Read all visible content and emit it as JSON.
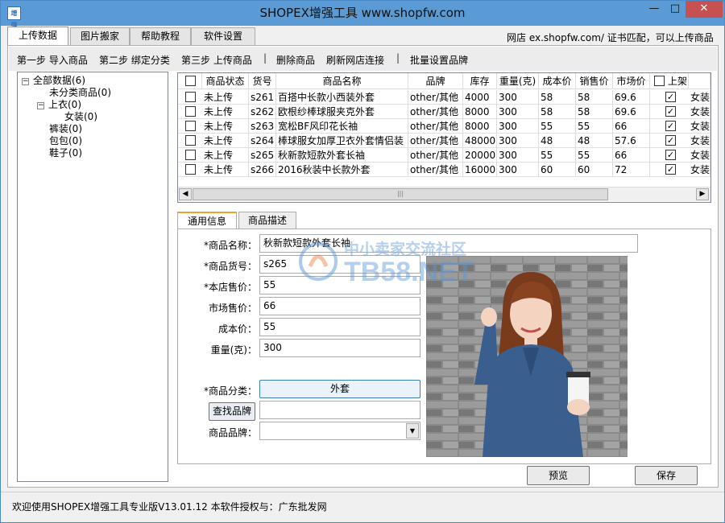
{
  "window": {
    "title": "SHOPEX增强工具 www.shopfw.com",
    "icon_text": "增强"
  },
  "main_tabs": [
    "上传数据",
    "图片搬家",
    "帮助教程",
    "软件设置"
  ],
  "notice": "网店 ex.shopfw.com/ 证书匹配，可以上传商品",
  "toolbar": {
    "step1": "第一步 导入商品",
    "step2": "第二步 绑定分类",
    "step3": "第三步 上传商品",
    "sep": "|",
    "delete": "删除商品",
    "refresh": "刷新网店连接",
    "batch_brand": "批量设置品牌"
  },
  "tree": {
    "root": "全部数据(6)",
    "uncategorized": "未分类商品(0)",
    "tops": "上衣(0)",
    "women": "女装(0)",
    "pants": "裤装(0)",
    "bags": "包包(0)",
    "shoes": "鞋子(0)"
  },
  "grid": {
    "headers": [
      "商品状态",
      "货号",
      "商品名称",
      "品牌",
      "库存",
      "重量(克)",
      "成本价",
      "销售价",
      "市场价",
      "上架",
      ""
    ],
    "rows": [
      {
        "status": "未上传",
        "sku": "s261",
        "name": "百搭中长款小西装外套",
        "brand": "other/其他",
        "stock": "4000",
        "weight": "300",
        "cost": "58",
        "price": "58",
        "market": "69.6",
        "listed": "✓",
        "cat": "女装"
      },
      {
        "status": "未上传",
        "sku": "s262",
        "name": "欧根纱棒球服夹克外套",
        "brand": "other/其他",
        "stock": "8000",
        "weight": "300",
        "cost": "58",
        "price": "58",
        "market": "69.6",
        "listed": "✓",
        "cat": "女装"
      },
      {
        "status": "未上传",
        "sku": "s263",
        "name": "宽松BF风印花长袖",
        "brand": "other/其他",
        "stock": "8000",
        "weight": "300",
        "cost": "55",
        "price": "55",
        "market": "66",
        "listed": "✓",
        "cat": "女装"
      },
      {
        "status": "未上传",
        "sku": "s264",
        "name": "棒球服女加厚卫衣外套情侣装",
        "brand": "other/其他",
        "stock": "48000",
        "weight": "300",
        "cost": "48",
        "price": "48",
        "market": "57.6",
        "listed": "✓",
        "cat": "女装"
      },
      {
        "status": "未上传",
        "sku": "s265",
        "name": "秋新款短款外套长袖",
        "brand": "other/其他",
        "stock": "20000",
        "weight": "300",
        "cost": "55",
        "price": "55",
        "market": "66",
        "listed": "✓",
        "cat": "女装"
      },
      {
        "status": "未上传",
        "sku": "s266",
        "name": "2016秋装中长款外套",
        "brand": "other/其他",
        "stock": "16000",
        "weight": "300",
        "cost": "60",
        "price": "60",
        "market": "72",
        "listed": "✓",
        "cat": "女装"
      }
    ],
    "scroll_left": "◀",
    "scroll_right": "▶",
    "scroll_grip": "|||"
  },
  "detail_tabs": [
    "通用信息",
    "商品描述"
  ],
  "form": {
    "name_label": "*商品名称：",
    "name_value": "秋新款短款外套长袖",
    "sku_label": "*商品货号：",
    "sku_value": "s265",
    "price_label": "*本店售价：",
    "price_value": "55",
    "market_label": "市场售价：",
    "market_value": "66",
    "cost_label": "成本价：",
    "cost_value": "55",
    "weight_label": "重量(克)：",
    "weight_value": "300",
    "category_label": "*商品分类：",
    "category_value": "外套",
    "find_brand": "查找品牌",
    "brand_search_value": "",
    "brand_label": "商品品牌：",
    "brand_value": "",
    "select_arrow": "▼"
  },
  "watermark": {
    "line1": "中小卖家交流社区",
    "line2": "TB58.NET"
  },
  "buttons": {
    "preview": "预览",
    "save": "保存"
  },
  "status": "欢迎使用SHOPEX增强工具专业版V13.01.12   本软件授权与：广东批发网",
  "colors": {
    "titlebar": "#5b9bd5",
    "close": "#c75050",
    "tab_accent": "#f0a030"
  }
}
